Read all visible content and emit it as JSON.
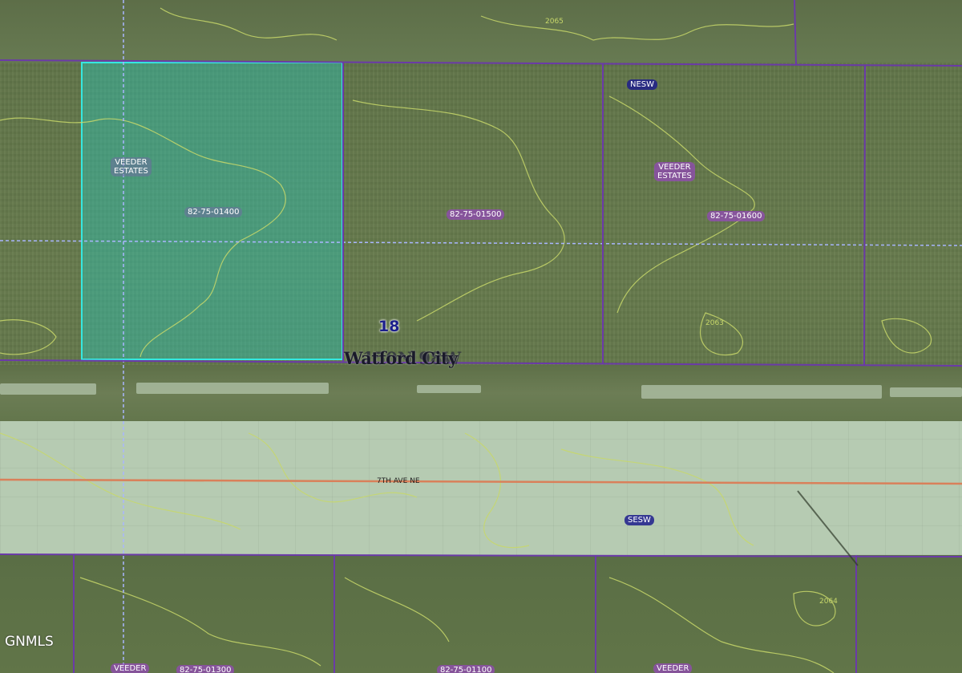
{
  "map": {
    "labels": {
      "plss_nesw": "NESW",
      "plss_sesw": "SESW",
      "subdivision_left": "VEEDER\nESTATES",
      "subdivision_right": "VEEDER\nESTATES",
      "subdivision_bottom_left": "VEEDER",
      "subdivision_bottom_right": "VEEDER",
      "parcel_1400": "82-75-01400",
      "parcel_1500": "82-75-01500",
      "parcel_1600": "82-75-01600",
      "parcel_bottom_a": "82-75-01300",
      "parcel_bottom_b": "82-75-01100",
      "section_number": "18",
      "city_name": "Watford City",
      "city_overlap": "150N 98W",
      "road_name": "7TH AVE NE",
      "contour_2065": "2065",
      "contour_2063": "2063",
      "contour_2064": "2064"
    },
    "colors": {
      "parcel_line": "#6b3aa8",
      "highlight_fill": "#28c8b9",
      "highlight_border": "#35e8e0",
      "road_centerline": "#d9805a",
      "section_dashed": "#a9b6ff",
      "contour": "#c8d86a"
    }
  },
  "watermark": "GNMLS"
}
